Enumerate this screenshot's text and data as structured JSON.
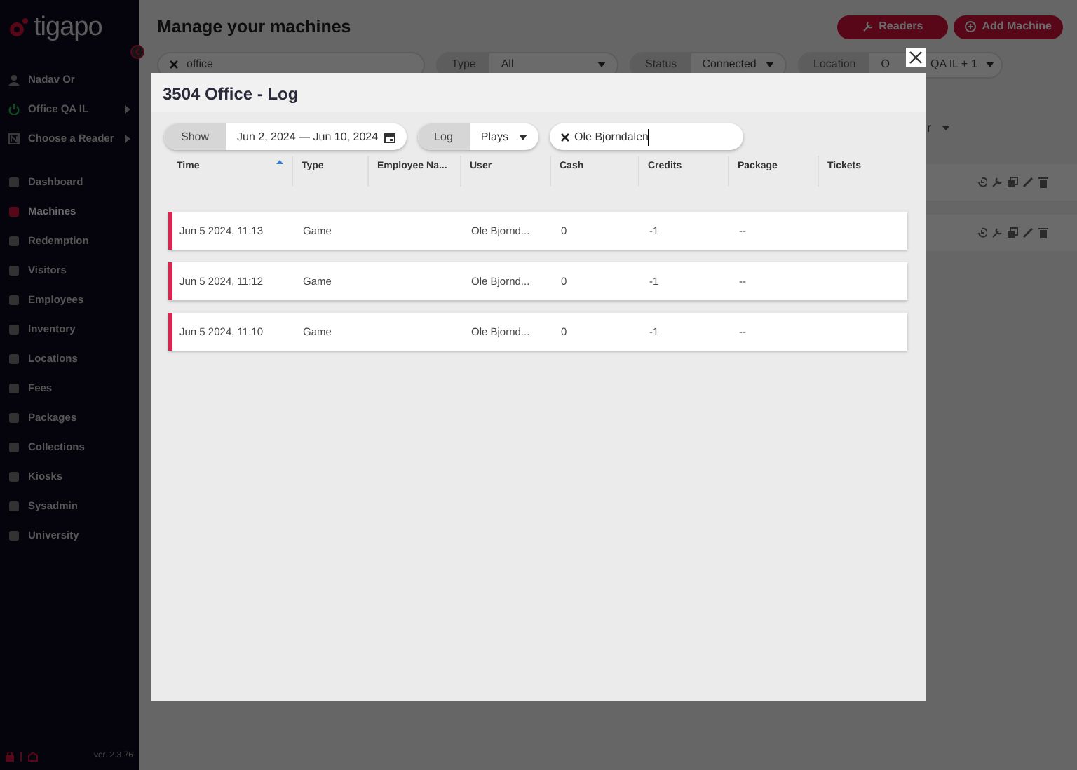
{
  "sidebar": {
    "logo": "tigapo",
    "user": "Nadav Or",
    "location": "Office QA IL",
    "reader": "Choose a Reader",
    "items": [
      {
        "label": "Dashboard",
        "selected": false
      },
      {
        "label": "Machines",
        "selected": true
      },
      {
        "label": "Redemption",
        "selected": false
      },
      {
        "label": "Visitors",
        "selected": false
      },
      {
        "label": "Employees",
        "selected": false
      },
      {
        "label": "Inventory",
        "selected": false
      },
      {
        "label": "Locations",
        "selected": false
      },
      {
        "label": "Fees",
        "selected": false
      },
      {
        "label": "Packages",
        "selected": false
      },
      {
        "label": "Collections",
        "selected": false
      },
      {
        "label": "Kiosks",
        "selected": false
      },
      {
        "label": "Sysadmin",
        "selected": false
      },
      {
        "label": "University",
        "selected": false
      }
    ],
    "version": "ver. 2.3.76"
  },
  "page": {
    "title": "Manage your machines",
    "buttons": [
      "Readers",
      "Add Machine"
    ],
    "search": "office",
    "filters": [
      {
        "label": "Type",
        "value": "All"
      },
      {
        "label": "Status",
        "value": "Connected"
      },
      {
        "label": "Location",
        "value_start": "O",
        "value_end": "QA IL + 1"
      }
    ],
    "column_picker": "r"
  },
  "modal": {
    "title": "3504 Office - Log",
    "show_label": "Show",
    "date_range": "Jun 2, 2024 — Jun 10, 2024",
    "log_label": "Log",
    "log_value": "Plays",
    "search": "Ole Bjorndalen",
    "columns": [
      {
        "label": "Time",
        "sorted": true
      },
      {
        "label": "Type",
        "sorted": false
      },
      {
        "label": "Employee Na...",
        "sorted": false
      },
      {
        "label": "User",
        "sorted": false
      },
      {
        "label": "Cash",
        "sorted": false
      },
      {
        "label": "Credits",
        "sorted": false
      },
      {
        "label": "Package",
        "sorted": false
      },
      {
        "label": "Tickets",
        "sorted": false
      }
    ],
    "rows": [
      [
        "Jun 5 2024, 11:13",
        "Game",
        "",
        "Ole Bjornd...",
        "0",
        "-1",
        "--",
        ""
      ],
      [
        "Jun 5 2024, 11:12",
        "Game",
        "",
        "Ole Bjornd...",
        "0",
        "-1",
        "--",
        ""
      ],
      [
        "Jun 5 2024, 11:10",
        "Game",
        "",
        "Ole Bjornd...",
        "0",
        "-1",
        "--",
        ""
      ]
    ]
  }
}
